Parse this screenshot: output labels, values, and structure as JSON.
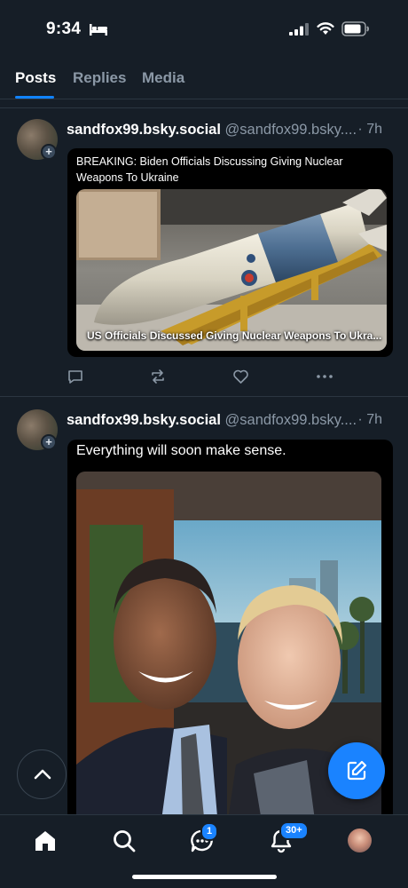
{
  "status_bar": {
    "time": "9:34",
    "icons": [
      "bed-icon",
      "signal-icon",
      "wifi-icon",
      "battery-icon"
    ]
  },
  "tabs": [
    {
      "label": "Posts",
      "active": true
    },
    {
      "label": "Replies",
      "active": false
    },
    {
      "label": "Media",
      "active": false
    }
  ],
  "posts": [
    {
      "display_name": "sandfox99.bsky.social",
      "handle": "@sandfox99.bsky....",
      "time_ago": "· 7h",
      "headline": "BREAKING: Biden Officials Discussing Giving Nuclear Weapons To Ukraine",
      "image_caption": "US Officials Discussed Giving Nuclear Weapons To Ukra..."
    },
    {
      "display_name": "sandfox99.bsky.social",
      "handle": "@sandfox99.bsky....",
      "time_ago": "· 7h",
      "meme_text": "Everything will soon make sense."
    }
  ],
  "nav": {
    "chat_badge": "1",
    "notifications_badge": "30+"
  },
  "colors": {
    "accent": "#1083fe",
    "background": "#161e27",
    "muted_text": "#8b98a6"
  }
}
